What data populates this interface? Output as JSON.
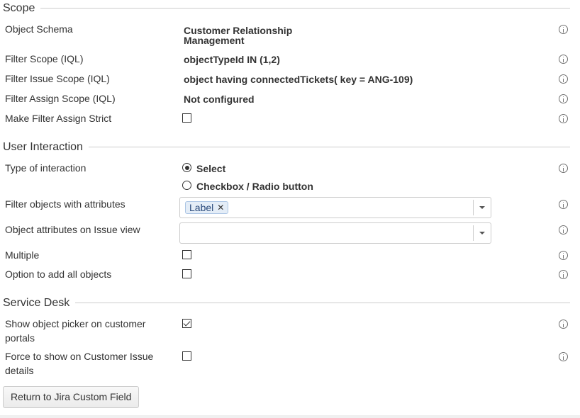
{
  "sections": {
    "scope": "Scope",
    "user_interaction": "User Interaction",
    "service_desk": "Service Desk"
  },
  "scope": {
    "object_schema_label": "Object Schema",
    "object_schema_value_line1": "Customer Relationship",
    "object_schema_value_line2": "Management",
    "filter_scope_label": "Filter Scope (IQL)",
    "filter_scope_value": "objectTypeId IN (1,2)",
    "filter_issue_scope_label": "Filter Issue Scope (IQL)",
    "filter_issue_scope_value": "object having connectedTickets( key = ANG-109)",
    "filter_assign_scope_label": "Filter Assign Scope (IQL)",
    "filter_assign_scope_value": "Not configured",
    "make_filter_assign_strict_label": "Make Filter Assign Strict",
    "make_filter_assign_strict_checked": false
  },
  "user_interaction": {
    "type_label": "Type of interaction",
    "options": [
      "Select",
      "Checkbox / Radio button"
    ],
    "selected_option": "Select",
    "filter_attributes_label": "Filter objects with attributes",
    "filter_attributes_tag": "Label",
    "issue_view_attributes_label": "Object attributes on Issue view",
    "multiple_label": "Multiple",
    "multiple_checked": false,
    "add_all_label": "Option to add all objects",
    "add_all_checked": false
  },
  "service_desk": {
    "show_picker_label_line1": "Show object picker on customer",
    "show_picker_label_line2": "portals",
    "show_picker_checked": true,
    "force_show_label_line1": "Force to show on Customer Issue",
    "force_show_label_line2": "details",
    "force_show_checked": false
  },
  "actions": {
    "return_button": "Return to Jira Custom Field"
  },
  "icons": {
    "info": "info-icon",
    "remove_tag": "close-icon",
    "dropdown": "chevron-down-icon"
  }
}
